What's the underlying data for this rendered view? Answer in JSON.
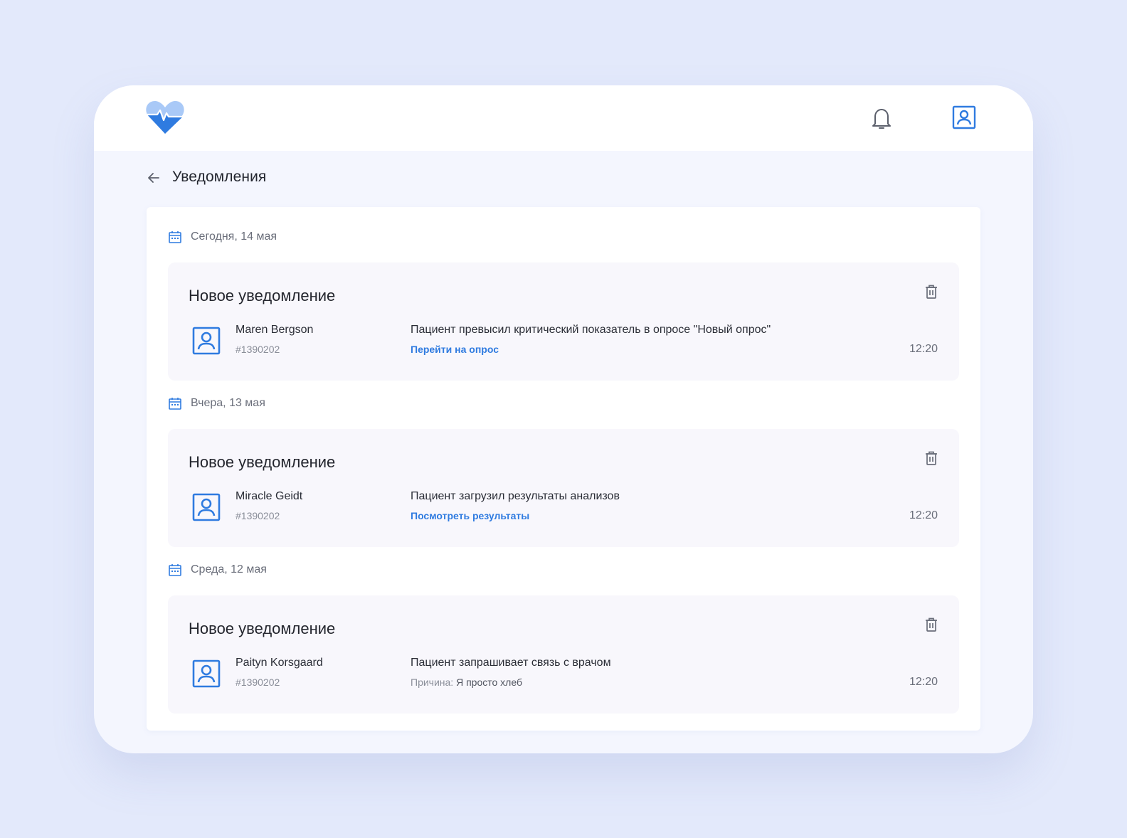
{
  "header": {
    "logo": "heart-pulse-logo",
    "notifications_icon": "bell-icon",
    "profile_icon": "user-profile-icon"
  },
  "page": {
    "back_icon": "arrow-left-icon",
    "title": "Уведомления"
  },
  "colors": {
    "accent": "#2f7be0",
    "background": "#e3e9fb",
    "card": "#f8f7fc"
  },
  "groups": [
    {
      "date": "Сегодня, 14 мая",
      "notification": {
        "title": "Новое уведомление",
        "patient_name": "Maren Bergson",
        "patient_id": "#1390202",
        "message": "Пациент превысил критический показатель в опросе \"Новый опрос\"",
        "link": "Перейти на опрос",
        "time": "12:20"
      }
    },
    {
      "date": "Вчера, 13 мая",
      "notification": {
        "title": "Новое уведомление",
        "patient_name": "Miracle Geidt",
        "patient_id": "#1390202",
        "message": "Пациент загрузил результаты анализов",
        "link": "Посмотреть результаты",
        "time": "12:20"
      }
    },
    {
      "date": "Среда, 12 мая",
      "notification": {
        "title": "Новое уведомление",
        "patient_name": "Paityn Korsgaard",
        "patient_id": "#1390202",
        "message": "Пациент запрашивает связь с врачом",
        "reason_label": "Причина:",
        "reason_value": "Я просто хлеб",
        "time": "12:20"
      }
    }
  ]
}
